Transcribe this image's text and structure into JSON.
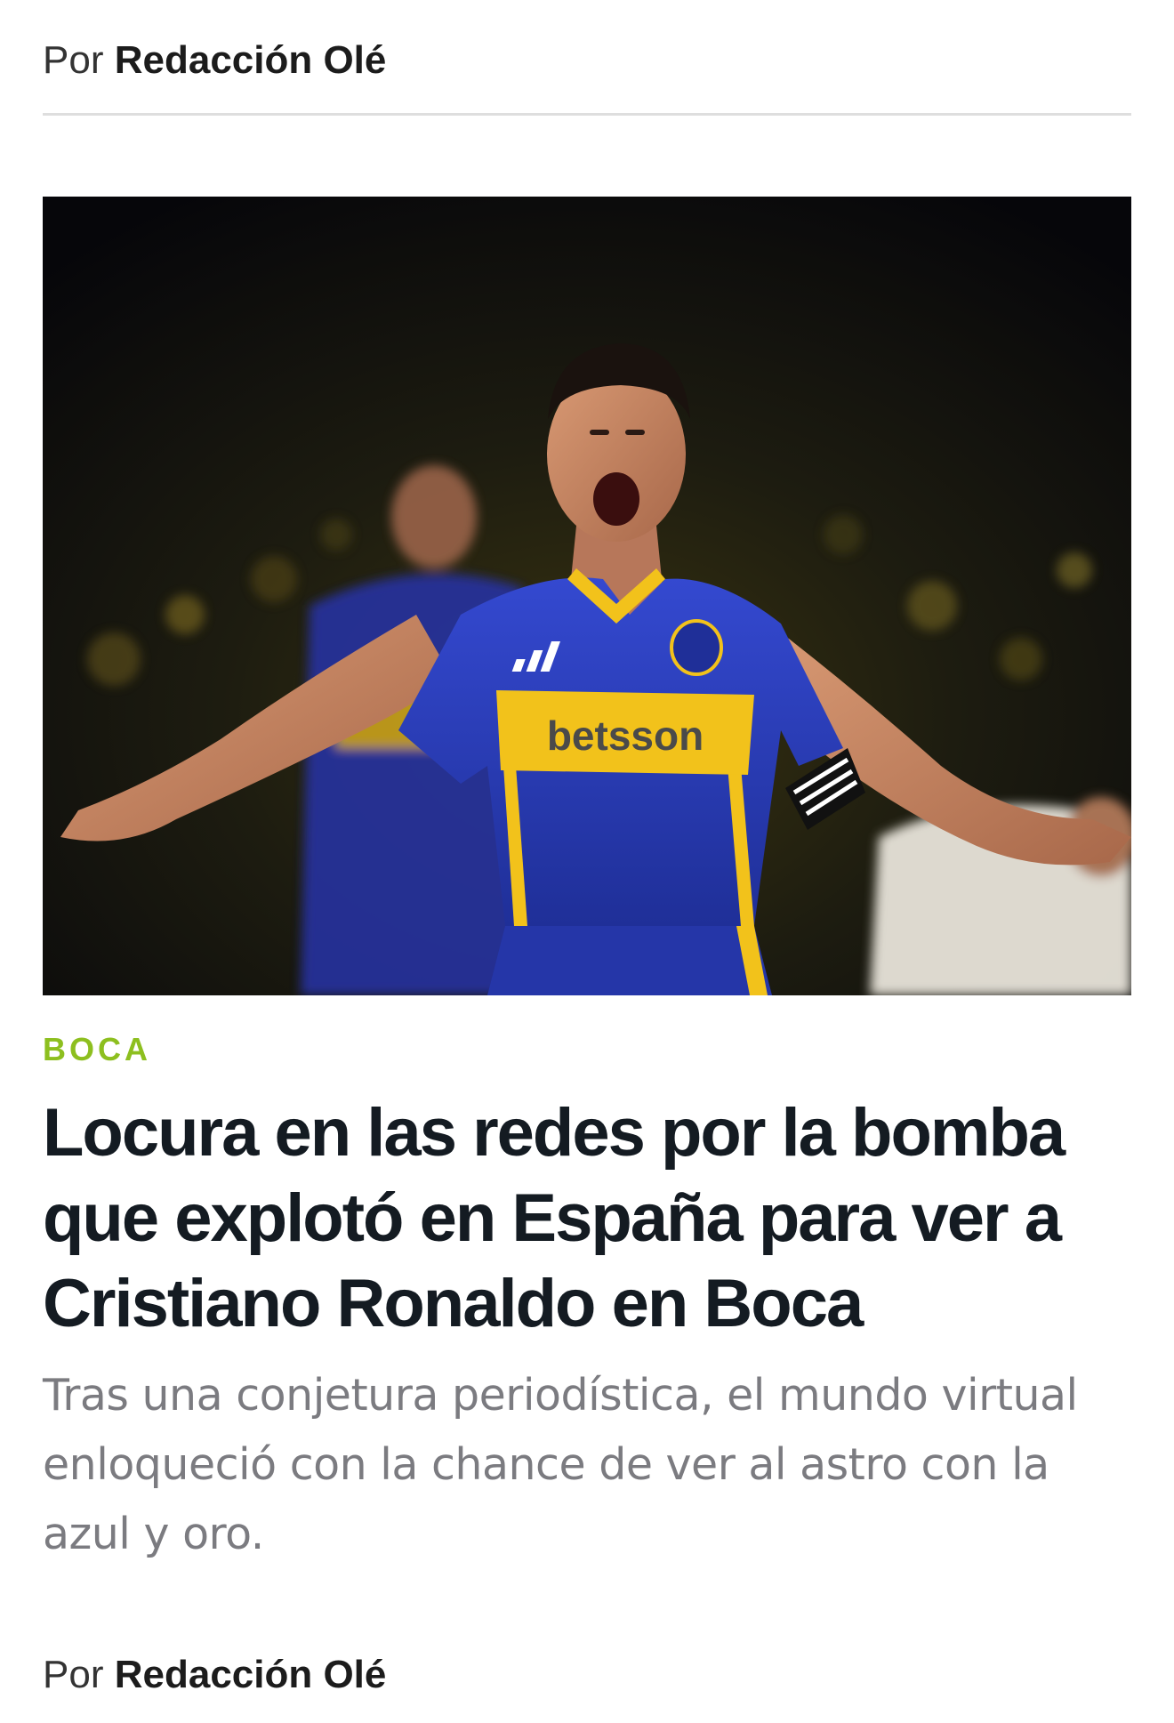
{
  "byline_top": {
    "prefix": "Por",
    "author": "Redacción Olé"
  },
  "hero_image": {
    "alt": "Cristiano Ronaldo con la camiseta de Boca",
    "shirt_sponsor": "betsson"
  },
  "article": {
    "category": "BOCA",
    "headline": "Locura en las redes por la bomba que explotó en España para ver a Cristiano Ronaldo en Boca",
    "subhead": "Tras una conjetura periodística, el mundo virtual enloqueció con la chance de ver al astro con la azul y oro."
  },
  "byline_bottom": {
    "prefix": "Por",
    "author": "Redacción Olé"
  },
  "colors": {
    "category": "#8dbf1f",
    "headline": "#141b22",
    "subhead": "#7b7b80",
    "boca_blue": "#2b3fb8",
    "boca_gold": "#f2c21b"
  }
}
